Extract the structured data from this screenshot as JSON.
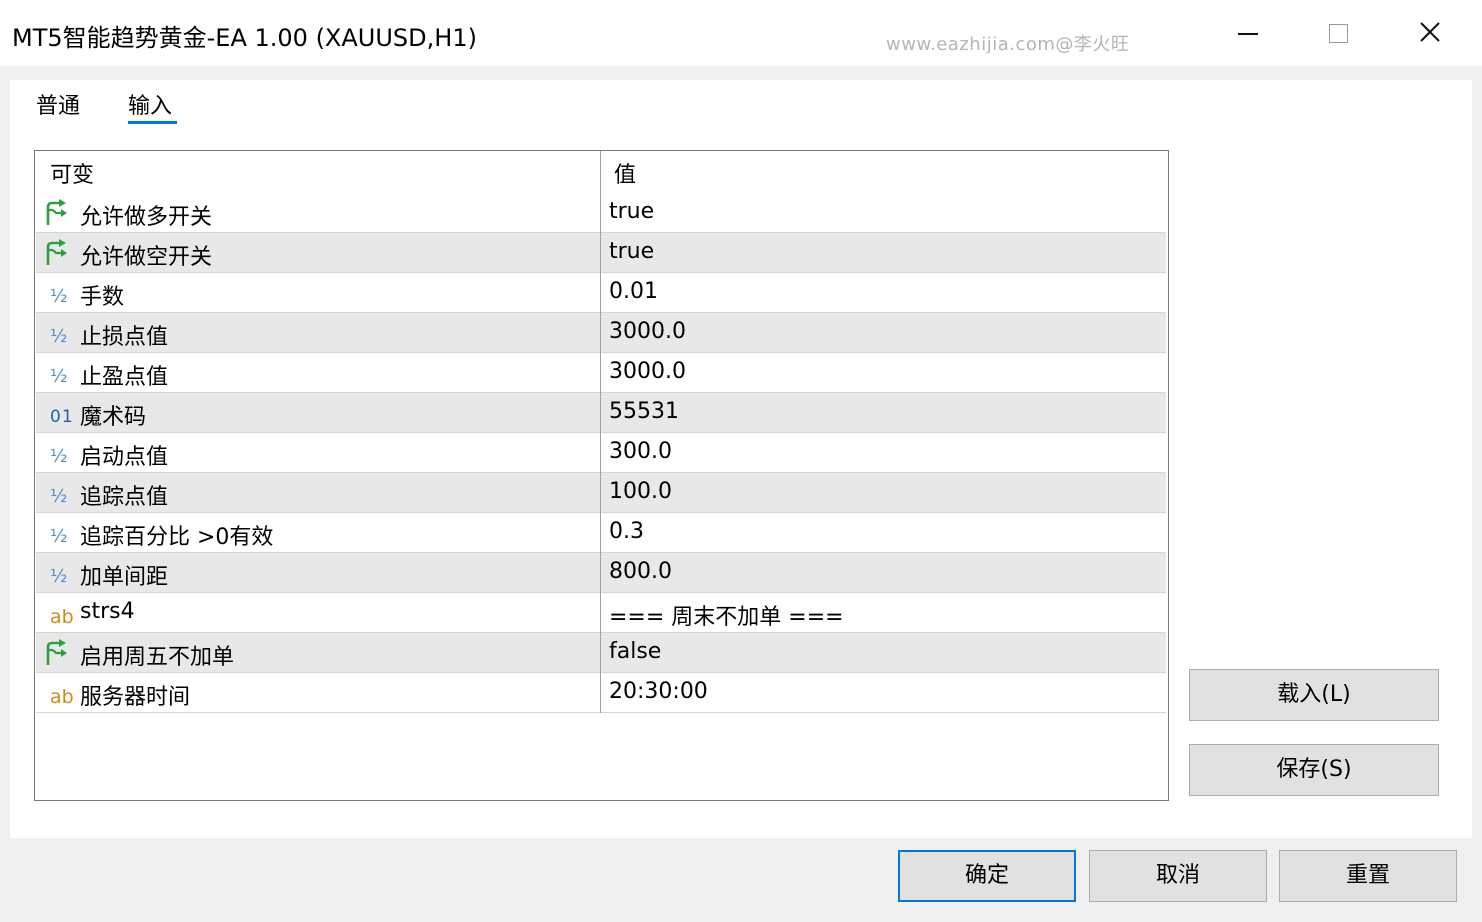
{
  "window": {
    "title": "MT5智能趋势黄金-EA 1.00 (XAUUSD,H1)",
    "watermark": "www.eazhijia.com@李火旺",
    "minimize_icon": "minimize-icon",
    "maximize_icon": "maximize-icon",
    "close_icon": "close-icon"
  },
  "tabs": [
    {
      "label": "普通",
      "selected": false
    },
    {
      "label": "输入",
      "selected": true
    }
  ],
  "grid": {
    "headers": {
      "name": "可变",
      "value": "值"
    },
    "rows": [
      {
        "icon": "bool-arrow-icon",
        "icon_text": "",
        "name": "允许做多开关",
        "value": "true"
      },
      {
        "icon": "bool-arrow-icon",
        "icon_text": "",
        "name": "允许做空开关",
        "value": "true"
      },
      {
        "icon": "double-half-icon",
        "icon_text": "½",
        "name": "手数",
        "value": "0.01"
      },
      {
        "icon": "double-half-icon",
        "icon_text": "½",
        "name": "止损点值",
        "value": "3000.0"
      },
      {
        "icon": "double-half-icon",
        "icon_text": "½",
        "name": "止盈点值",
        "value": "3000.0"
      },
      {
        "icon": "int-01-icon",
        "icon_text": "01",
        "name": "魔术码",
        "value": "55531"
      },
      {
        "icon": "double-half-icon",
        "icon_text": "½",
        "name": "启动点值",
        "value": "300.0"
      },
      {
        "icon": "double-half-icon",
        "icon_text": "½",
        "name": "追踪点值",
        "value": "100.0"
      },
      {
        "icon": "double-half-icon",
        "icon_text": "½",
        "name": "追踪百分比 >0有效",
        "value": "0.3"
      },
      {
        "icon": "double-half-icon",
        "icon_text": "½",
        "name": "加单间距",
        "value": "800.0"
      },
      {
        "icon": "string-ab-icon",
        "icon_text": "ab",
        "name": "strs4",
        "value": "=== 周末不加单 ==="
      },
      {
        "icon": "bool-arrow-icon",
        "icon_text": "",
        "name": "启用周五不加单",
        "value": "false"
      },
      {
        "icon": "string-ab-icon",
        "icon_text": "ab",
        "name": "服务器时间",
        "value": "20:30:00"
      }
    ]
  },
  "side_buttons": {
    "load": "载入(L)",
    "save": "保存(S)"
  },
  "footer_buttons": {
    "ok": "确定",
    "cancel": "取消",
    "reset": "重置"
  },
  "colors": {
    "accent": "#0078d7",
    "bool_icon": "#2e9e3e",
    "double_icon": "#4f8fd0",
    "int_icon": "#1a64b3",
    "string_icon": "#d08a1a"
  }
}
